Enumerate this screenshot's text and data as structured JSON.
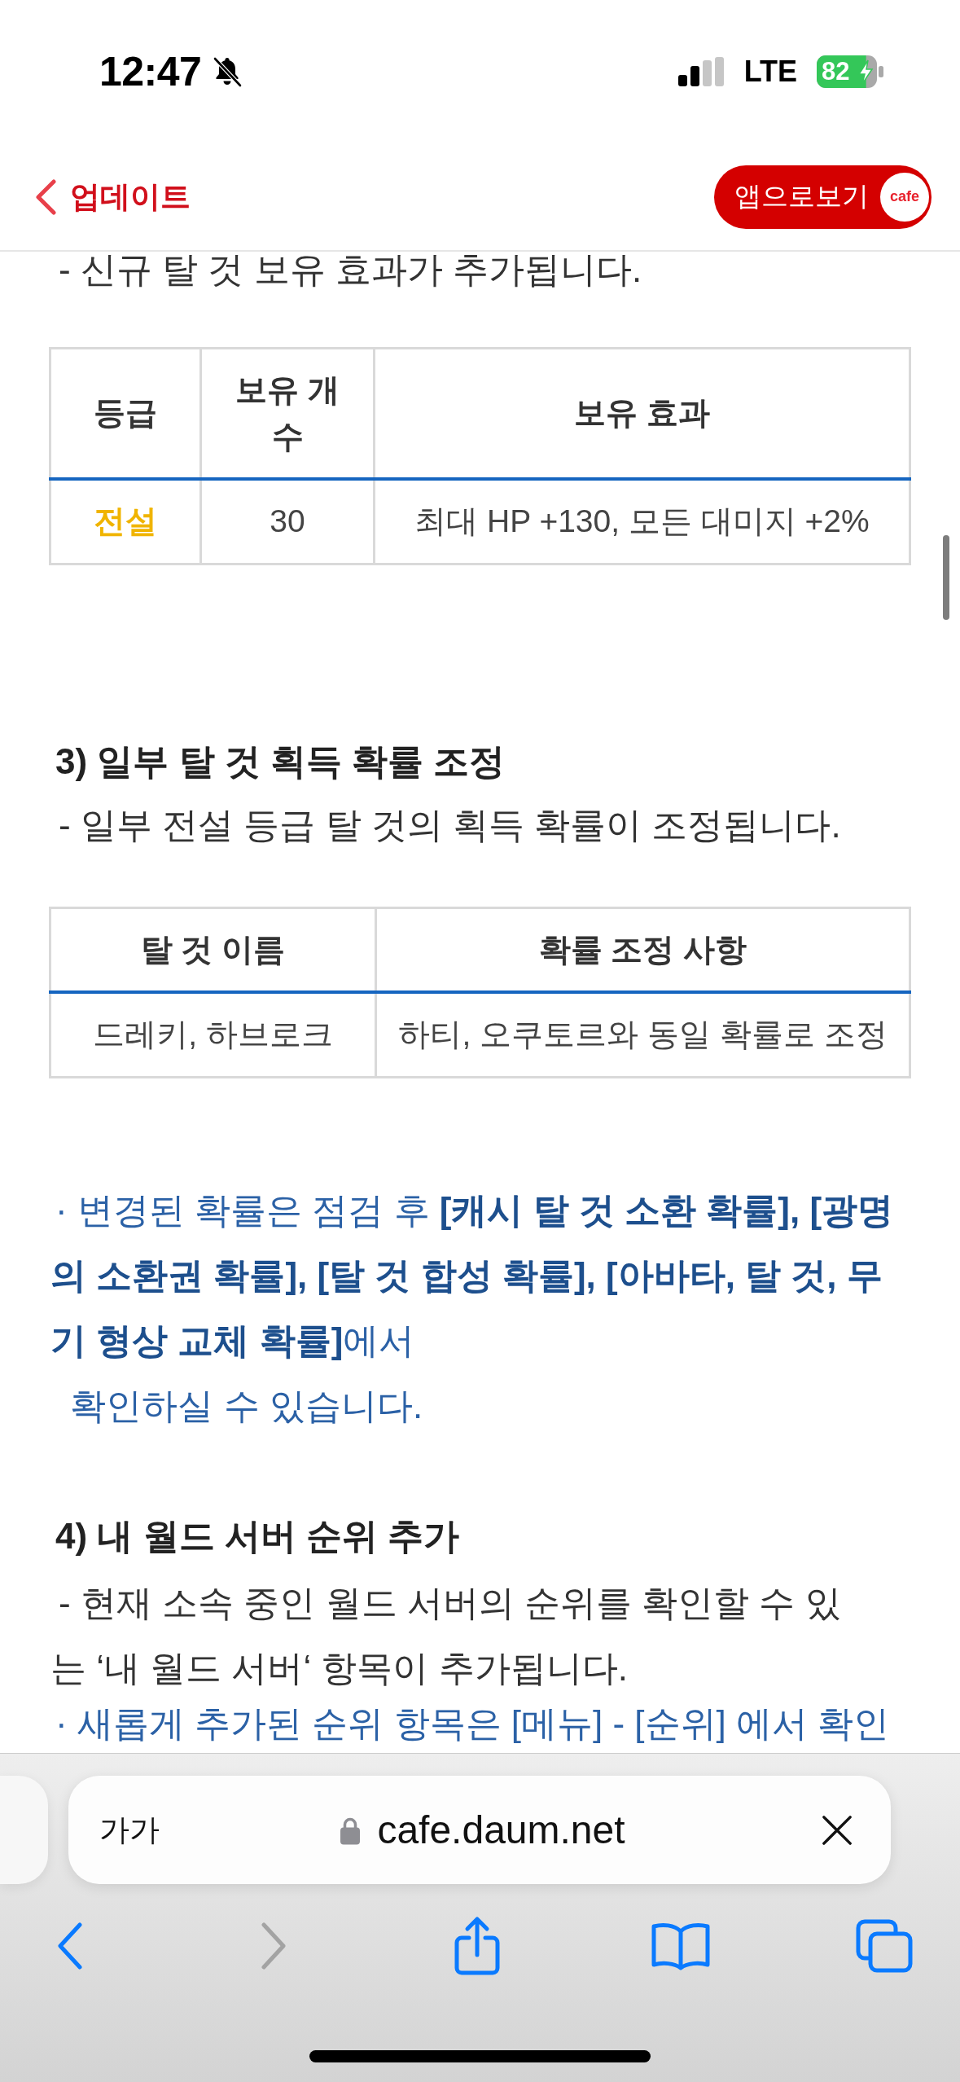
{
  "status_bar": {
    "time": "12:47",
    "network": "LTE",
    "battery": "82"
  },
  "header": {
    "title": "업데이트",
    "app_button": {
      "label": "앱으로보기",
      "logo": "cafe"
    }
  },
  "article": {
    "blocks": [
      {
        "kind": "text",
        "text": "- 신규 탈 것 보유 효과가 추가됩니다."
      },
      {
        "kind": "table",
        "columns": [
          "등급",
          "보유 개수",
          "보유 효과"
        ],
        "rows": [
          {
            "cells": [
              "전설",
              "30",
              "최대 HP +130, 모든 대미지 +2%"
            ],
            "color": "#f0b400"
          }
        ]
      },
      {
        "kind": "heading",
        "text": "3) 일부 탈 것 획득 확률 조정"
      },
      {
        "kind": "text",
        "text": "- 일부 전설 등급 탈 것의 획득 확률이 조정됩니다."
      },
      {
        "kind": "table",
        "columns": [
          "탈 것 이름",
          "확률 조정 사항"
        ],
        "rows": [
          {
            "cells": [
              "드레키, 하브로크",
              "하티, 오쿠토르와 동일 확률로 조정"
            ]
          }
        ]
      },
      {
        "kind": "note",
        "text": "· 변경된 확률은 점검 후 **[캐시 탈 것 소환 확률], [광명의 소환권 확률], [탈 것 합성 확률], [아바타, 탈 것, 무기 형상 교체 확률]**에서\n  확인하실 수 있습니다."
      },
      {
        "kind": "heading",
        "text": "4) 내 월드 서버 순위 추가"
      },
      {
        "kind": "text",
        "text": "- 현재 소속 중인 월드 서버의 순위를 확인할 수 있는 ‘내 월드 서버‘ 항목이 추가됩니다."
      },
      {
        "kind": "note",
        "text": "· 새롭게 추가된 순위 항목은 [메뉴] - [순위] 에서 확인"
      }
    ]
  },
  "browser": {
    "text_size": "가가",
    "url": "cafe.daum.net",
    "toolbar": [
      {
        "kind": "back",
        "disabled": false
      },
      {
        "kind": "forward",
        "disabled": true
      },
      {
        "kind": "share",
        "disabled": false
      },
      {
        "kind": "bookmarks",
        "disabled": false
      },
      {
        "kind": "tabs",
        "disabled": false
      }
    ]
  }
}
